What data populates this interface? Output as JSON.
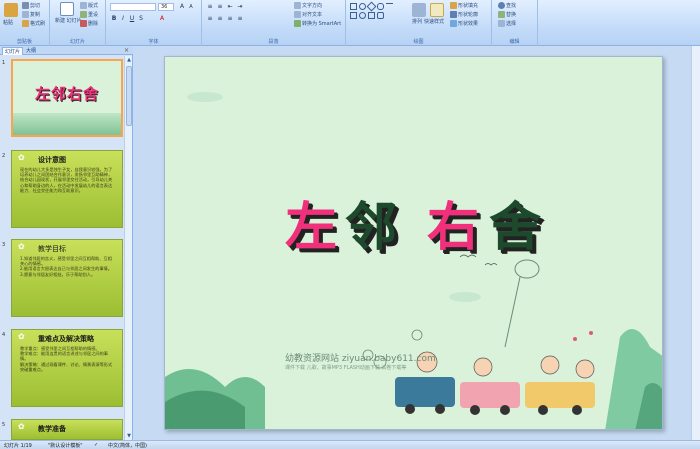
{
  "ribbon": {
    "groups": [
      {
        "label": "剪贴板"
      },
      {
        "label": "幻灯片"
      },
      {
        "label": "字体"
      },
      {
        "label": "段落"
      },
      {
        "label": "绘图"
      },
      {
        "label": "编辑"
      }
    ],
    "clipboard": {
      "paste": "粘贴",
      "cut": "剪切",
      "copy": "复制",
      "format_painter": "格式刷"
    },
    "slides": {
      "new_slide": "新建\n幻灯片",
      "layout": "版式",
      "reset": "重设",
      "delete": "删除"
    },
    "font": {
      "font_name": "",
      "font_size": "36"
    },
    "paragraph": {
      "text_direction": "文字方向",
      "align_text": "对齐文本",
      "smartart": "转换为 SmartArt"
    },
    "drawing": {
      "arrange": "排列",
      "quick_styles": "快速样式",
      "shape_fill": "形状填充",
      "shape_outline": "形状轮廓",
      "shape_effects": "形状效果"
    },
    "editing": {
      "find": "查找",
      "replace": "替换",
      "select": "选择"
    }
  },
  "panel": {
    "tabs": [
      "幻灯片",
      "大纲"
    ],
    "close": "×",
    "slides": [
      {
        "num": "1",
        "title": "左邻右舍"
      },
      {
        "num": "2",
        "title": "设计意图",
        "body": "现在的幼儿大多是独生子女，自我意识较强，为了培养幼儿之间团结合作意识，发扬邻里互助精神，结合幼儿园现状，开展邻里交往活动，引导幼儿关心和帮助身边的人，在活动中发展幼儿的语言表达能力、社会交往能力和互助意识。"
      },
      {
        "num": "3",
        "title": "教学目标",
        "body": "1.知道邻居的含义，感受邻里之间互相帮助、互相关心的情感。\n2.能用语言大胆表达自己与邻居之间发生的事情。\n3.愿意与邻居友好相处，乐于帮助别人。"
      },
      {
        "num": "4",
        "title": "重难点及解决策略",
        "body": "教学重点：感受邻里之间互相帮助的情感。\n教学难点：能用连贯的语言讲述与邻居之间的事情。\n解决策略：通过观看课件、讨论、情景表演等形式突破重难点。"
      },
      {
        "num": "5",
        "title": "教学准备"
      }
    ]
  },
  "slide": {
    "title_chars": [
      {
        "char": "左",
        "color": "#f0307a"
      },
      {
        "char": "邻",
        "color": "#1d4a2c"
      },
      {
        "char": "右",
        "color": "#f0307a"
      },
      {
        "char": "舍",
        "color": "#1d4a2c"
      }
    ],
    "watermark": "幼教资源网站  ziyuan.baby611.com",
    "watermark_sub": "课件下载  儿歌、故事MP3  FLASH动画下载  试卷下载等"
  },
  "status": {
    "slide_counter": "幻灯片 1/19",
    "theme": "\"默认设计模板\"",
    "language": "中文(简体，中国)"
  }
}
